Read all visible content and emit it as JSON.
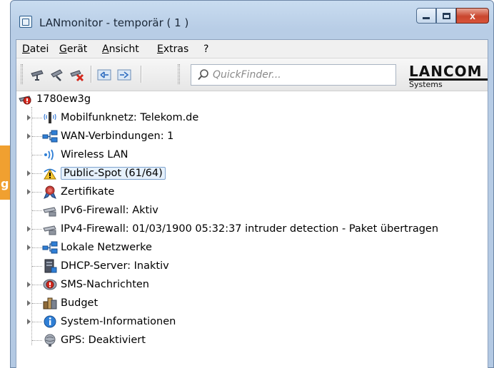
{
  "window": {
    "title": "LANmonitor - temporär ( 1 )",
    "close_glyph": "x"
  },
  "menu": {
    "items": [
      "Datei",
      "Gerät",
      "Ansicht",
      "Extras",
      "?"
    ]
  },
  "toolbar": {
    "quickfinder_placeholder": "QuickFinder...",
    "logo_main": "LANCOM",
    "logo_sub": "Systems"
  },
  "background": {
    "fragment": "g"
  },
  "tree": {
    "root": "1780ew3g",
    "items": [
      {
        "label": "Mobilfunknetz: Telekom.de",
        "icon": "antenna-icon"
      },
      {
        "label": "WAN-Verbindungen: 1",
        "icon": "network-icon"
      },
      {
        "label": "Wireless LAN",
        "icon": "wireless-icon"
      },
      {
        "label": "Public-Spot (61/64)",
        "icon": "public-spot-warning-icon"
      },
      {
        "label": "Zertifikate",
        "icon": "certificate-icon"
      },
      {
        "label": "IPv6-Firewall: Aktiv",
        "icon": "firewall-icon"
      },
      {
        "label": "IPv4-Firewall: 01/03/1900 05:32:37 intruder detection - Paket übertragen",
        "icon": "firewall-icon"
      },
      {
        "label": "Lokale Netzwerke",
        "icon": "network-icon"
      },
      {
        "label": "DHCP-Server: Inaktiv",
        "icon": "server-icon"
      },
      {
        "label": "SMS-Nachrichten",
        "icon": "sms-icon"
      },
      {
        "label": "Budget",
        "icon": "budget-icon"
      },
      {
        "label": "System-Informationen",
        "icon": "info-icon"
      },
      {
        "label": "GPS: Deaktiviert",
        "icon": "gps-icon"
      }
    ]
  },
  "colors": {
    "selection_border": "#7da2ce",
    "selection_fill": "#e5f0fb",
    "close_button": "#c9462e",
    "accent_orange": "#f0a030"
  }
}
